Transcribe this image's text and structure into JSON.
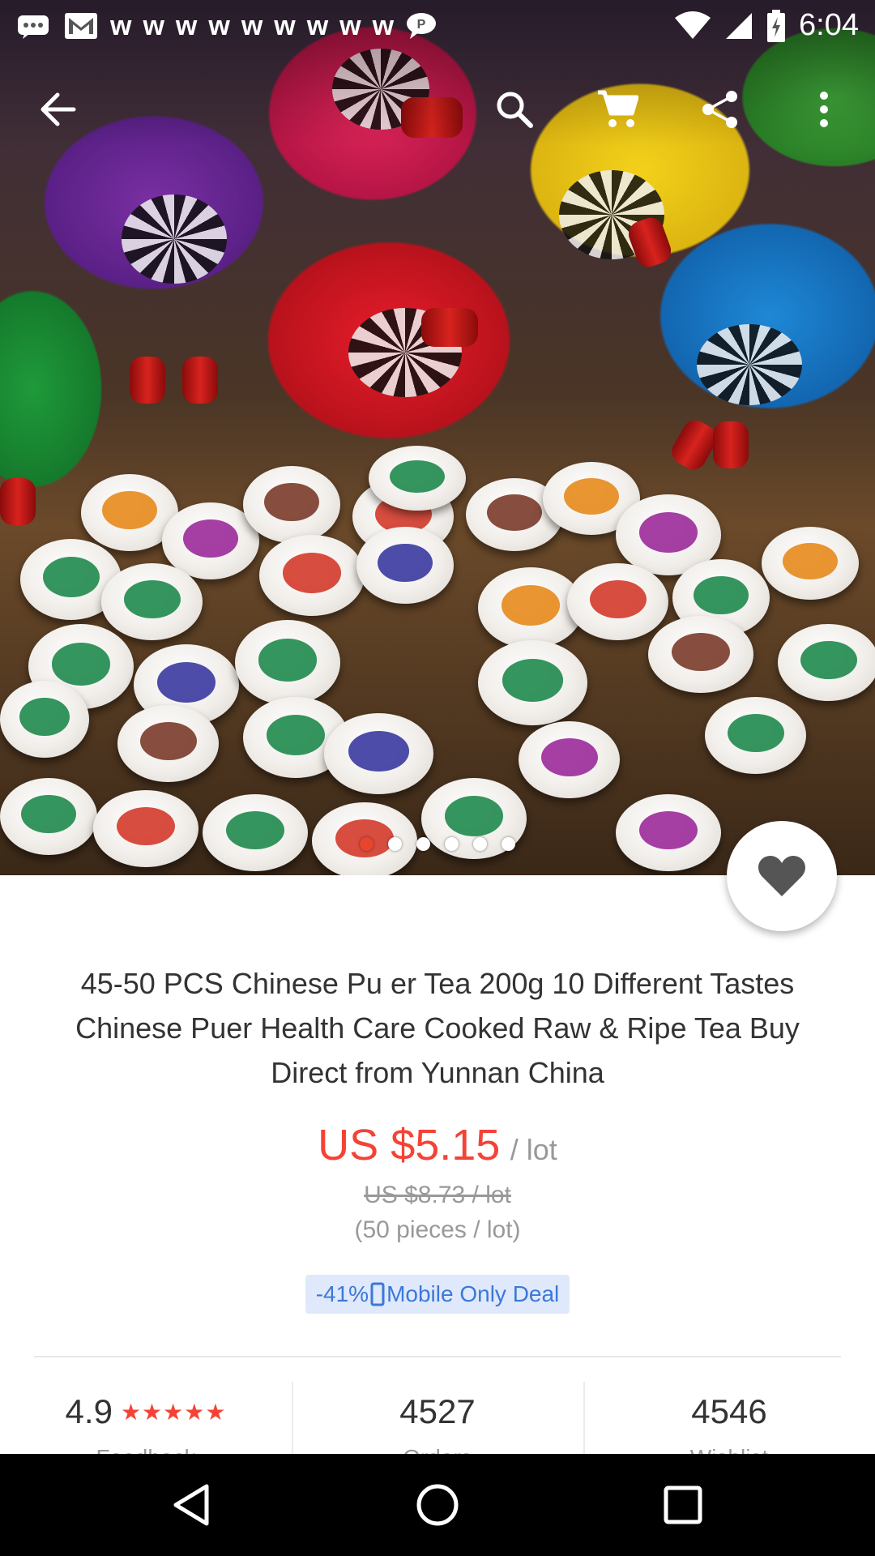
{
  "status_bar": {
    "time": "6:04",
    "notification_icons": [
      "messenger-icon",
      "gmail-icon",
      "w-icon",
      "w-icon",
      "w-icon",
      "w-icon",
      "w-icon",
      "w-icon",
      "w-icon",
      "w-icon",
      "w-icon",
      "chat-icon"
    ],
    "notification_glyph": "w"
  },
  "toolbar": {
    "icons": [
      "back-arrow-icon",
      "search-icon",
      "cart-icon",
      "share-icon",
      "more-vert-icon"
    ]
  },
  "image_pager": {
    "count": 6,
    "active_index": 0
  },
  "product": {
    "title": "45-50 PCS Chinese Pu er Tea 200g 10 Different Tastes Chinese Puer Health Care Cooked Raw & Ripe Tea Buy Direct from Yunnan China",
    "price": "US $5.15",
    "price_unit": "/ lot",
    "original_price": "US $8.73 / lot",
    "pieces": "(50 pieces / lot)",
    "deal_discount": "-41%",
    "deal_label": "Mobile Only Deal"
  },
  "stats": {
    "rating": "4.9",
    "stars": "★★★★★",
    "feedback_label": "Feedback",
    "orders": "4527",
    "orders_label": "Orders",
    "wishlist": "4546",
    "wishlist_label": "Wishlist"
  },
  "colors": {
    "price": "#f44336",
    "deal_text": "#3c78d8",
    "deal_bg": "#dfe9fb",
    "pager_active": "#e8452c"
  }
}
